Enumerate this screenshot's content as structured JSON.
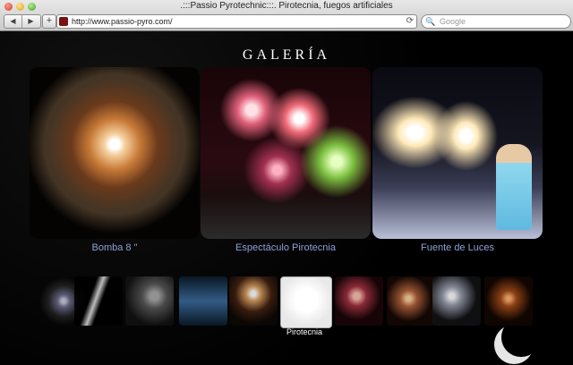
{
  "browser": {
    "title": ".:::Passio Pyrotechnic:::. Pirotecnia, fuegos artificiales",
    "url": "http://www.passio-pyro.com/",
    "search_placeholder": "Google",
    "back_icon": "◀",
    "forward_icon": "▶",
    "add_tab_icon": "+",
    "reload_icon": "⟳",
    "search_icon": "🔍"
  },
  "gallery": {
    "heading": "GALERÍA",
    "items": [
      {
        "caption": "Bomba 8 \""
      },
      {
        "caption": "Espectáculo Pirotecnia"
      },
      {
        "caption": "Fuente de Luces"
      }
    ],
    "thumbnail_tooltip": "Pirotecnia"
  },
  "colors": {
    "page_background": "#000000",
    "caption": "#8fa0d6"
  }
}
